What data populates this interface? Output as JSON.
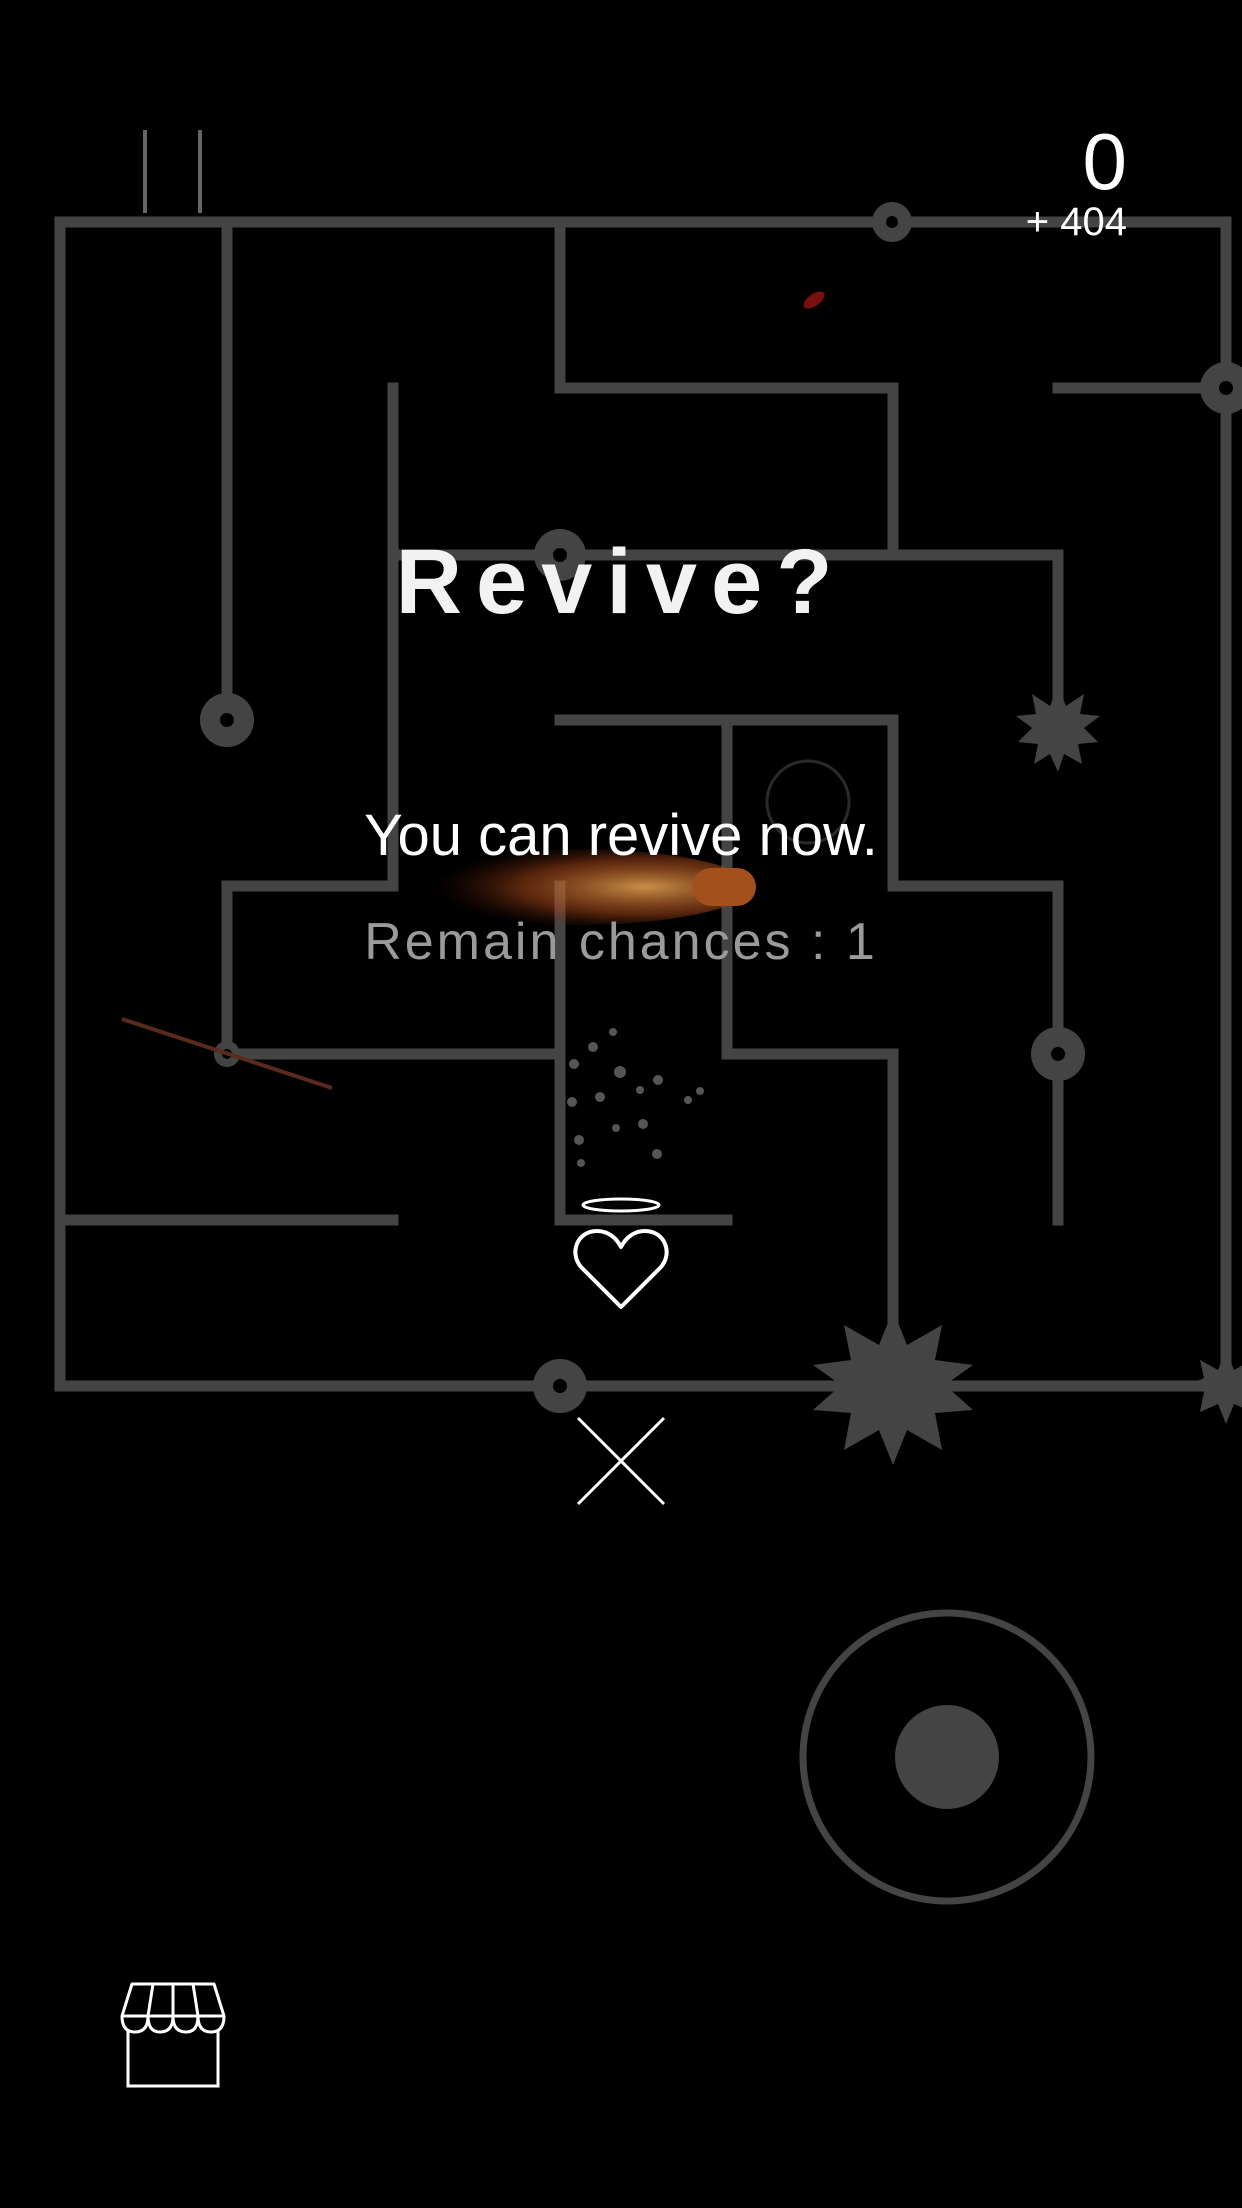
{
  "hud": {
    "score": "0",
    "bonus": "+ 404",
    "pause_icon": "pause-icon",
    "shop_icon": "shop-icon"
  },
  "revive_dialog": {
    "title": "Revive?",
    "message": "You can revive now.",
    "chances": "Remain chances : 1",
    "revive_icon": "heart-with-halo-icon",
    "close_icon": "close-x-icon"
  },
  "joystick": {
    "icon": "joystick-icon"
  },
  "colors": {
    "background": "#000000",
    "maze_wall": "#444444",
    "text": "#ffffff",
    "muted_text": "#9a9a9a",
    "fireball": "#d2691e"
  }
}
